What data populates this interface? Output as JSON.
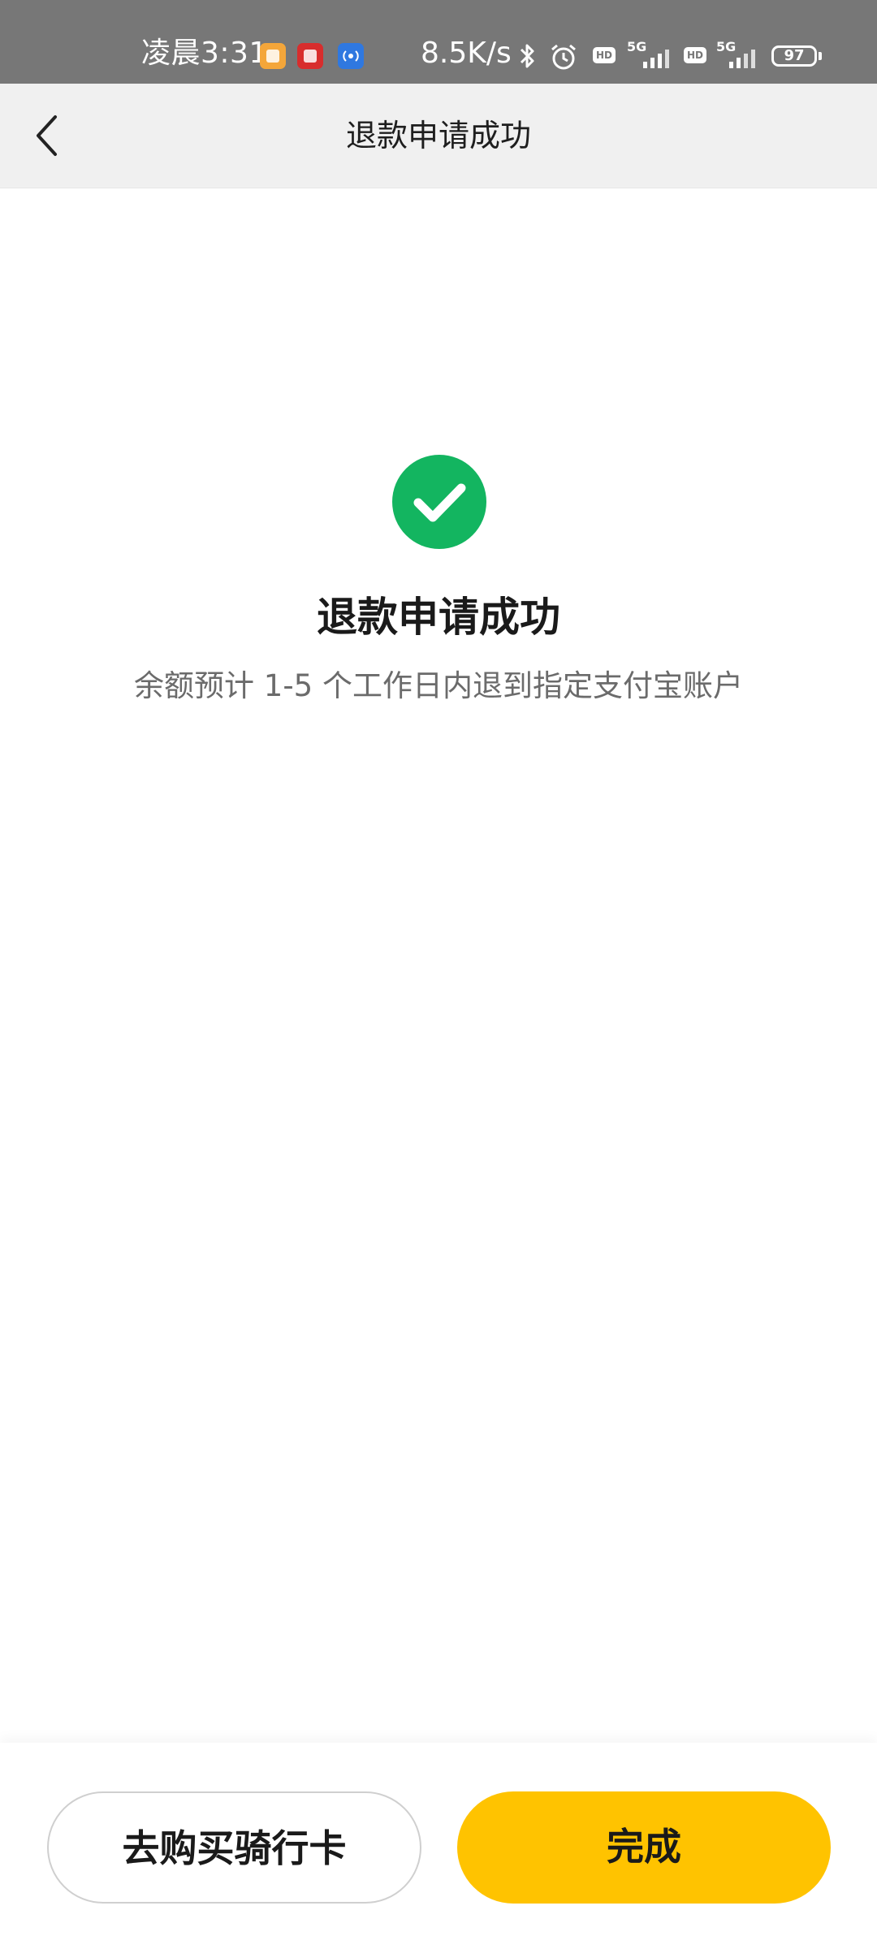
{
  "status_bar": {
    "time": "凌晨3:31",
    "speed": "8.5K/s",
    "network_1": "5G",
    "network_2": "5G",
    "battery": "97",
    "icons": [
      "notification-app-icon",
      "red-app-icon",
      "broadcast-app-icon",
      "bluetooth-icon",
      "alarm-icon",
      "hd-icon",
      "signal-icon",
      "hd-icon",
      "signal-icon",
      "battery-icon"
    ]
  },
  "nav": {
    "title": "退款申请成功"
  },
  "result": {
    "title": "退款申请成功",
    "description": "余额预计 1-5 个工作日内退到指定支付宝账户",
    "icon": "success-check-icon",
    "icon_color": "#13b560"
  },
  "actions": {
    "secondary_label": "去购买骑行卡",
    "primary_label": "完成",
    "primary_color": "#ffc300"
  }
}
